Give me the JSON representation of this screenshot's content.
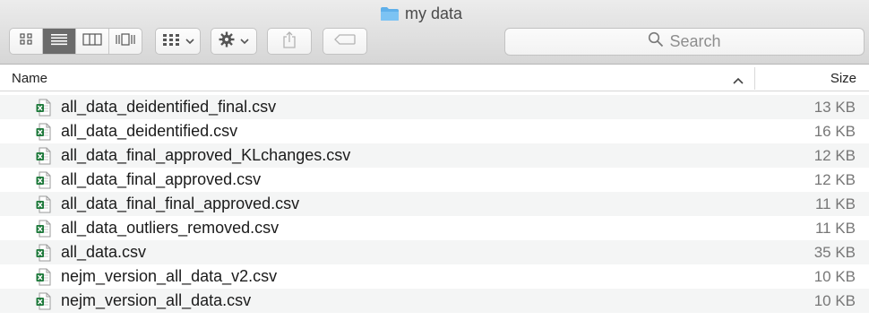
{
  "window": {
    "title": "my data"
  },
  "toolbar": {
    "view_buttons": [
      "icon-view-icon",
      "list-view-icon",
      "column-view-icon",
      "cover-flow-icon"
    ],
    "search_placeholder": "Search"
  },
  "columns": {
    "name": "Name",
    "size": "Size"
  },
  "files": [
    {
      "name": "all_data_deidentified_final.csv",
      "size": "13 KB"
    },
    {
      "name": "all_data_deidentified.csv",
      "size": "16 KB"
    },
    {
      "name": "all_data_final_approved_KLchanges.csv",
      "size": "12 KB"
    },
    {
      "name": "all_data_final_approved.csv",
      "size": "12 KB"
    },
    {
      "name": "all_data_final_final_approved.csv",
      "size": "11 KB"
    },
    {
      "name": "all_data_outliers_removed.csv",
      "size": "11 KB"
    },
    {
      "name": "all_data.csv",
      "size": "35 KB"
    },
    {
      "name": "nejm_version_all_data_v2.csv",
      "size": "10 KB"
    },
    {
      "name": "nejm_version_all_data.csv",
      "size": "10 KB"
    }
  ],
  "colors": {
    "folder": "#5fb0ea",
    "excel": "#1f7a3c",
    "active_segment": "#6b6b6b"
  }
}
